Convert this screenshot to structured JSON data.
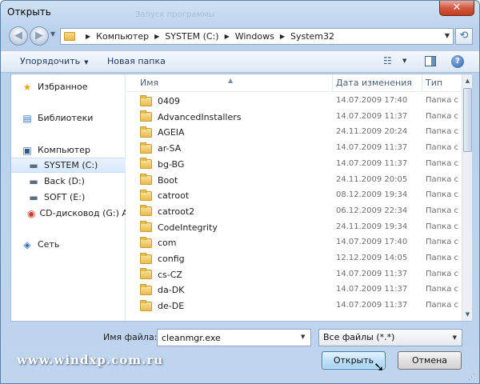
{
  "window": {
    "title": "Открыть",
    "ghost_title": "Запуск программы",
    "close_glyph": "✕"
  },
  "navigation": {
    "back_glyph": "◀",
    "forward_glyph": "▶",
    "history_glyph": "▼",
    "breadcrumb": [
      "Компьютер",
      "SYSTEM (C:)",
      "Windows",
      "System32"
    ],
    "refresh_glyph": "⟲"
  },
  "toolbar": {
    "organize_label": "Упорядочить",
    "new_folder_label": "Новая папка",
    "help_label": "?"
  },
  "nav_pane": {
    "favorites": "Избранное",
    "libraries": "Библиотеки",
    "computer": "Компьютер",
    "drives": [
      "SYSTEM (C:)",
      "Back (D:)",
      "SOFT (E:)",
      "CD-дисковод (G:) A"
    ],
    "network": "Сеть",
    "selected": "SYSTEM (C:)"
  },
  "file_list": {
    "columns": [
      "Имя",
      "Дата изменения",
      "Тип"
    ],
    "rows": [
      {
        "name": "0409",
        "date": "14.07.2009 17:40",
        "type": "Папка с ф"
      },
      {
        "name": "AdvancedInstallers",
        "date": "14.07.2009 11:37",
        "type": "Папка с ф"
      },
      {
        "name": "AGEIA",
        "date": "24.11.2009 20:24",
        "type": "Папка с ф"
      },
      {
        "name": "ar-SA",
        "date": "14.07.2009 11:37",
        "type": "Папка с ф"
      },
      {
        "name": "bg-BG",
        "date": "14.07.2009 11:37",
        "type": "Папка с ф"
      },
      {
        "name": "Boot",
        "date": "24.11.2009 20:05",
        "type": "Папка с ф"
      },
      {
        "name": "catroot",
        "date": "08.12.2009 19:34",
        "type": "Папка с ф"
      },
      {
        "name": "catroot2",
        "date": "06.12.2009 22:34",
        "type": "Папка с ф"
      },
      {
        "name": "CodeIntegrity",
        "date": "24.11.2009 19:34",
        "type": "Папка с ф"
      },
      {
        "name": "com",
        "date": "14.07.2009 17:40",
        "type": "Папка с ф"
      },
      {
        "name": "config",
        "date": "12.12.2009 14:05",
        "type": "Папка с ф"
      },
      {
        "name": "cs-CZ",
        "date": "14.07.2009 11:37",
        "type": "Папка с ф"
      },
      {
        "name": "da-DK",
        "date": "14.07.2009 11:37",
        "type": "Папка с ф"
      },
      {
        "name": "de-DE",
        "date": "14.07.2009 11:37",
        "type": "Папка с ф"
      }
    ]
  },
  "bottom": {
    "filename_label": "Имя файла:",
    "filename_value": "cleanmgr.exe",
    "filter_value": "Все файлы (*.*)",
    "open_button": "Открыть",
    "cancel_button": "Отмена",
    "watermark": "www.windxp.com.ru"
  }
}
